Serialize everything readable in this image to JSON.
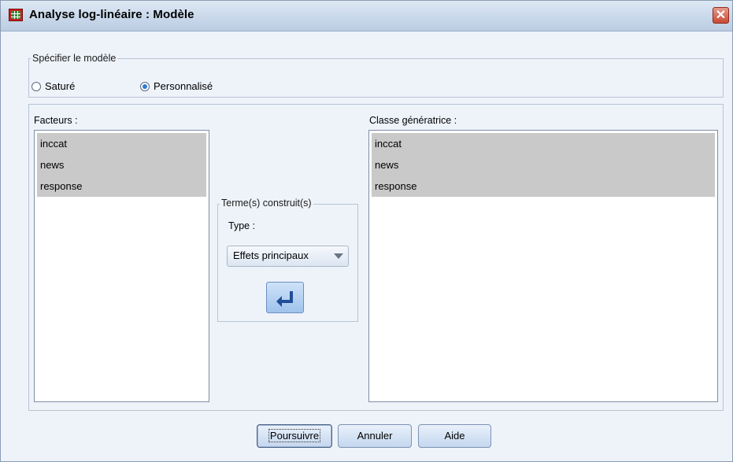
{
  "window": {
    "title": "Analyse log-linéaire : Modèle",
    "close_label": "✕"
  },
  "specify_model": {
    "legend": "Spécifier le modèle",
    "options": [
      {
        "label": "Saturé",
        "checked": false
      },
      {
        "label": "Personnalisé",
        "checked": true
      }
    ]
  },
  "factors": {
    "label": "Facteurs :",
    "items": [
      "inccat",
      "news",
      "response"
    ]
  },
  "build_terms": {
    "legend": "Terme(s) construit(s)",
    "type_label": "Type :",
    "type_value": "Effets principaux"
  },
  "generating_class": {
    "label": "Classe génératrice :",
    "items": [
      "inccat",
      "news",
      "response"
    ]
  },
  "buttons": {
    "continue": "Poursuivre",
    "cancel": "Annuler",
    "help": "Aide"
  },
  "icons": {
    "app": "spss-grid-icon",
    "close": "close-icon",
    "move": "move-arrow-icon",
    "dropdown": "chevron-down-icon"
  }
}
